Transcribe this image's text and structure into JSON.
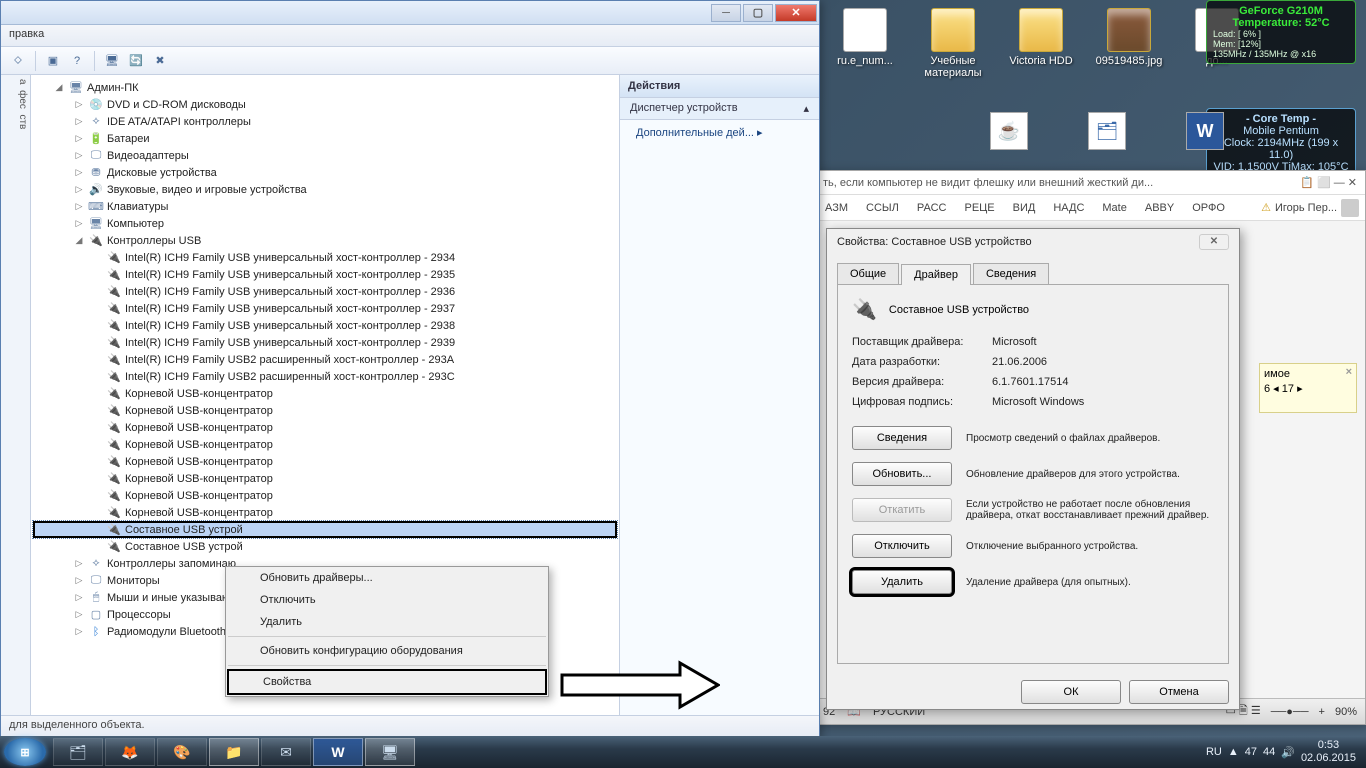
{
  "desktop_icons": [
    {
      "label": "ru.e_num...",
      "type": "file"
    },
    {
      "label": "Учебные материалы",
      "type": "folder"
    },
    {
      "label": "Victoria HDD",
      "type": "folder"
    },
    {
      "label": "09519485.jpg",
      "type": "img"
    },
    {
      "label": "до...",
      "type": "file"
    }
  ],
  "gpu": {
    "name": "GeForce G210M",
    "temp_label": "Temperature:",
    "temp": "52°C",
    "load": "Load: [ 6% ]",
    "mem": "Mem:  [12%]",
    "clk": "135MHz / 135MHz @ x16"
  },
  "coretemp": {
    "title": "- Core Temp -",
    "cpu": "Mobile Pentium",
    "clock": "Clock: 2194MHz (199 x 11.0)",
    "vid": "VID: 1.1500V  TjMax: 105°C"
  },
  "devmgr": {
    "menu": "правка",
    "root": "Админ-ПК",
    "cats": [
      "DVD и CD-ROM дисководы",
      "IDE ATA/ATAPI контроллеры",
      "Батареи",
      "Видеоадаптеры",
      "Дисковые устройства",
      "Звуковые, видео и игровые устройства",
      "Клавиатуры",
      "Компьютер"
    ],
    "usb_label": "Контроллеры USB",
    "usb": [
      "Intel(R) ICH9 Family USB универсальный хост-контроллер  - 2934",
      "Intel(R) ICH9 Family USB универсальный хост-контроллер  - 2935",
      "Intel(R) ICH9 Family USB универсальный хост-контроллер  - 2936",
      "Intel(R) ICH9 Family USB универсальный хост-контроллер  - 2937",
      "Intel(R) ICH9 Family USB универсальный хост-контроллер  - 2938",
      "Intel(R) ICH9 Family USB универсальный хост-контроллер  - 2939",
      "Intel(R) ICH9 Family USB2 расширенный хост-контроллер  -  293A",
      "Intel(R) ICH9 Family USB2 расширенный хост-контроллер  -  293C",
      "Корневой USB-концентратор",
      "Корневой USB-концентратор",
      "Корневой USB-концентратор",
      "Корневой USB-концентратор",
      "Корневой USB-концентратор",
      "Корневой USB-концентратор",
      "Корневой USB-концентратор",
      "Корневой USB-концентратор",
      "Составное USB устрой",
      "Составное USB устрой"
    ],
    "tail": [
      "Контроллеры запоминаю",
      "Мониторы",
      "Мыши и иные указываю",
      "Процессоры",
      "Радиомодули Bluetooth"
    ],
    "actions": {
      "hdr": "Действия",
      "grp": "Диспетчер устройств",
      "item": "Дополнительные дей..."
    },
    "status": "для выделенного объекта."
  },
  "ctx": [
    "Обновить драйверы...",
    "Отключить",
    "Удалить",
    "Обновить конфигурацию оборудования",
    "Свойства"
  ],
  "props": {
    "title": "Свойства: Составное USB устройство",
    "tabs": [
      "Общие",
      "Драйвер",
      "Сведения"
    ],
    "dev": "Составное USB устройство",
    "fields": {
      "provider_l": "Поставщик драйвера:",
      "provider": "Microsoft",
      "date_l": "Дата разработки:",
      "date": "21.06.2006",
      "ver_l": "Версия драйвера:",
      "ver": "6.1.7601.17514",
      "sig_l": "Цифровая подпись:",
      "sig": "Microsoft Windows"
    },
    "b_details": "Сведения",
    "d_details": "Просмотр сведений о файлах драйверов.",
    "b_update": "Обновить...",
    "d_update": "Обновление драйверов для этого устройства.",
    "b_rollback": "Откатить",
    "d_rollback": "Если устройство не работает после обновления драйвера, откат восстанавливает прежний драйвер.",
    "b_disable": "Отключить",
    "d_disable": "Отключение выбранного устройства.",
    "b_delete": "Удалить",
    "d_delete": "Удаление драйвера (для опытных).",
    "ok": "ОК",
    "cancel": "Отмена"
  },
  "word": {
    "title_partial": "ть, если компьютер не видит флешку или внешний жесткий ди...",
    "ribbon": [
      "АЗМ",
      "ССЫЛ",
      "РАСС",
      "РЕЦЕ",
      "ВИД",
      "НАДС",
      "Mate",
      "ABBY",
      "ОРФО"
    ],
    "user": "Игорь Пер...",
    "sidebar": {
      "l1": "имое",
      "l2": "6",
      "l3": "17"
    },
    "status": {
      "pg": "92",
      "lang": "РУССКИЙ",
      "zoom": "90%"
    }
  },
  "tray": {
    "lang": "RU",
    "t1": "47",
    "t2": "44",
    "time": "0:53",
    "date": "02.06.2015"
  }
}
